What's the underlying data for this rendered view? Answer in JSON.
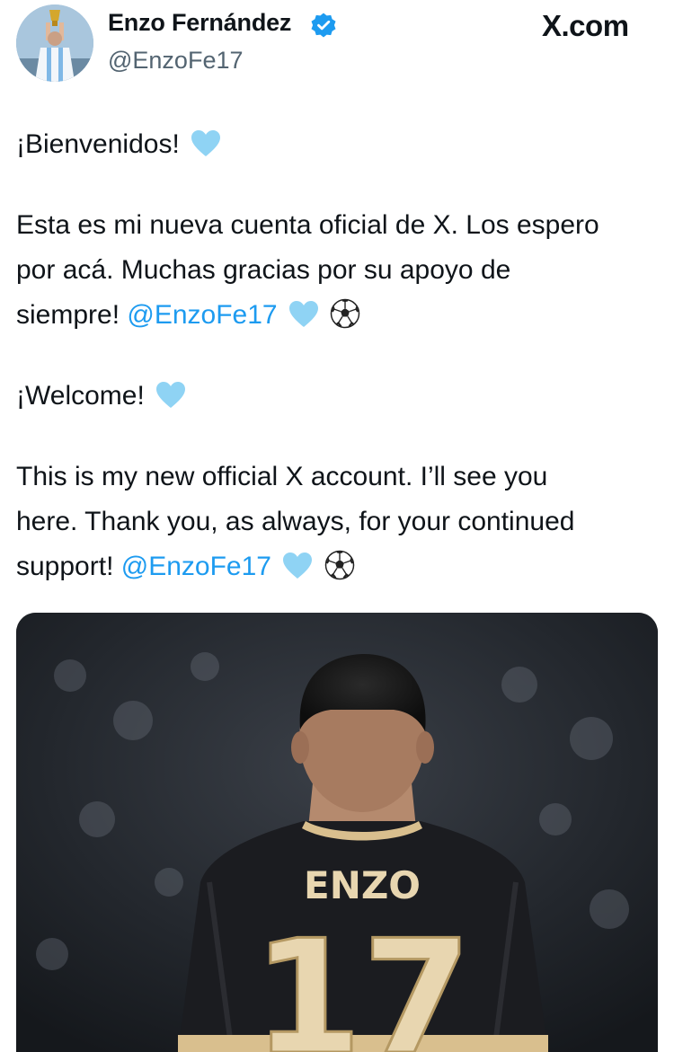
{
  "header": {
    "display_name": "Enzo Fernández",
    "handle": "@EnzoFe17",
    "site": "X.com"
  },
  "tweet": {
    "spanish_greeting": "¡Bienvenidos!",
    "spanish_line1": "Esta es mi nueva cuenta oficial de X. Los espero",
    "spanish_line2": "por acá. Muchas gracias por su apoyo de",
    "spanish_line3": "siempre!",
    "spanish_mention": "@EnzoFe17",
    "english_greeting": "¡Welcome!",
    "english_line1": "This is my new official X account. I’ll see you",
    "english_line2": "here. Thank you, as always, for your continued",
    "english_line3": "support!",
    "english_mention": "@EnzoFe17"
  },
  "media": {
    "shirt_name": "ENZO",
    "shirt_number": "17"
  },
  "colors": {
    "mention": "#1d9bf0",
    "verified": "#1d9bf0",
    "heart": "#8fd3f4",
    "jersey": "#1b1c20",
    "jersey_trim": "#d9bf8e"
  },
  "icons": [
    "verified-badge-icon",
    "light-blue-heart-icon",
    "soccer-ball-icon"
  ]
}
